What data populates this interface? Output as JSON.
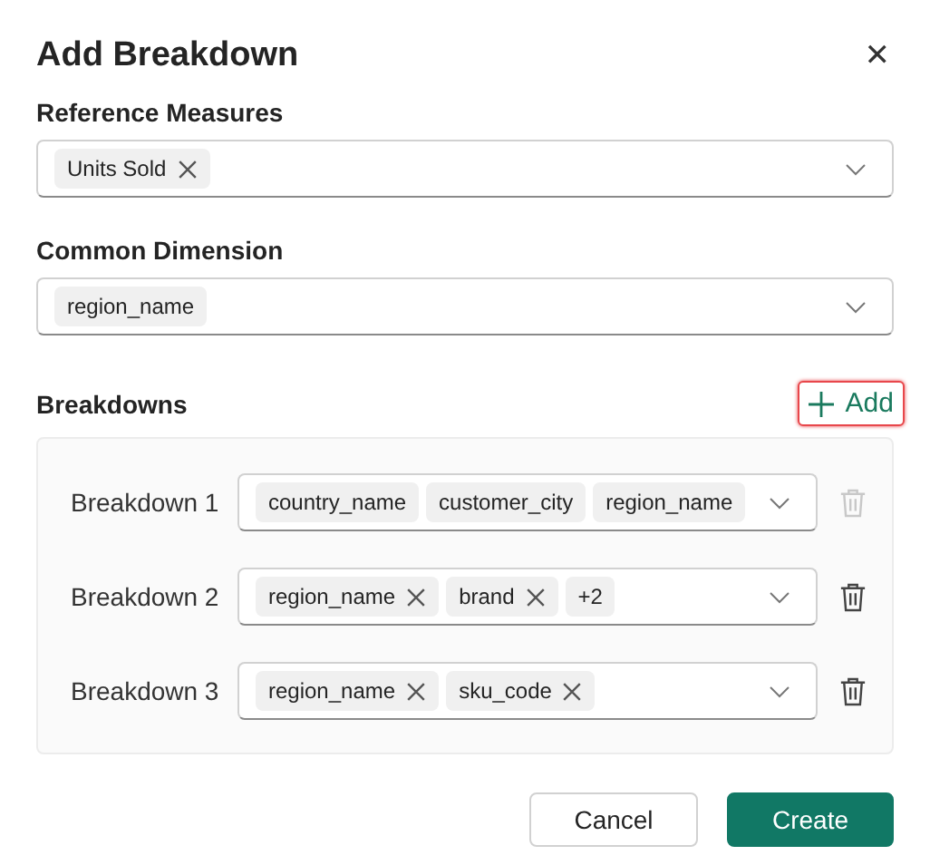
{
  "dialog": {
    "title": "Add Breakdown",
    "close": "✕"
  },
  "reference_measures": {
    "label": "Reference Measures",
    "tags": [
      {
        "text": "Units Sold",
        "removable": true
      }
    ]
  },
  "common_dimension": {
    "label": "Common Dimension",
    "tags": [
      {
        "text": "region_name",
        "removable": false
      }
    ]
  },
  "breakdowns": {
    "label": "Breakdowns",
    "add_button": {
      "label": "Add",
      "highlighted": true
    },
    "rows": [
      {
        "label": "Breakdown 1",
        "delete_disabled": true,
        "tags": [
          {
            "text": "country_name",
            "removable": false
          },
          {
            "text": "customer_city",
            "removable": false
          },
          {
            "text": "region_name",
            "removable": false
          }
        ]
      },
      {
        "label": "Breakdown 2",
        "delete_disabled": false,
        "tags": [
          {
            "text": "region_name",
            "removable": true
          },
          {
            "text": "brand",
            "removable": true
          },
          {
            "text": "+2",
            "removable": false
          }
        ]
      },
      {
        "label": "Breakdown 3",
        "delete_disabled": false,
        "tags": [
          {
            "text": "region_name",
            "removable": true
          },
          {
            "text": "sku_code",
            "removable": true
          }
        ]
      }
    ]
  },
  "buttons": [
    {
      "label": "Cancel",
      "kind": "secondary"
    },
    {
      "label": "Create",
      "kind": "primary"
    }
  ]
}
